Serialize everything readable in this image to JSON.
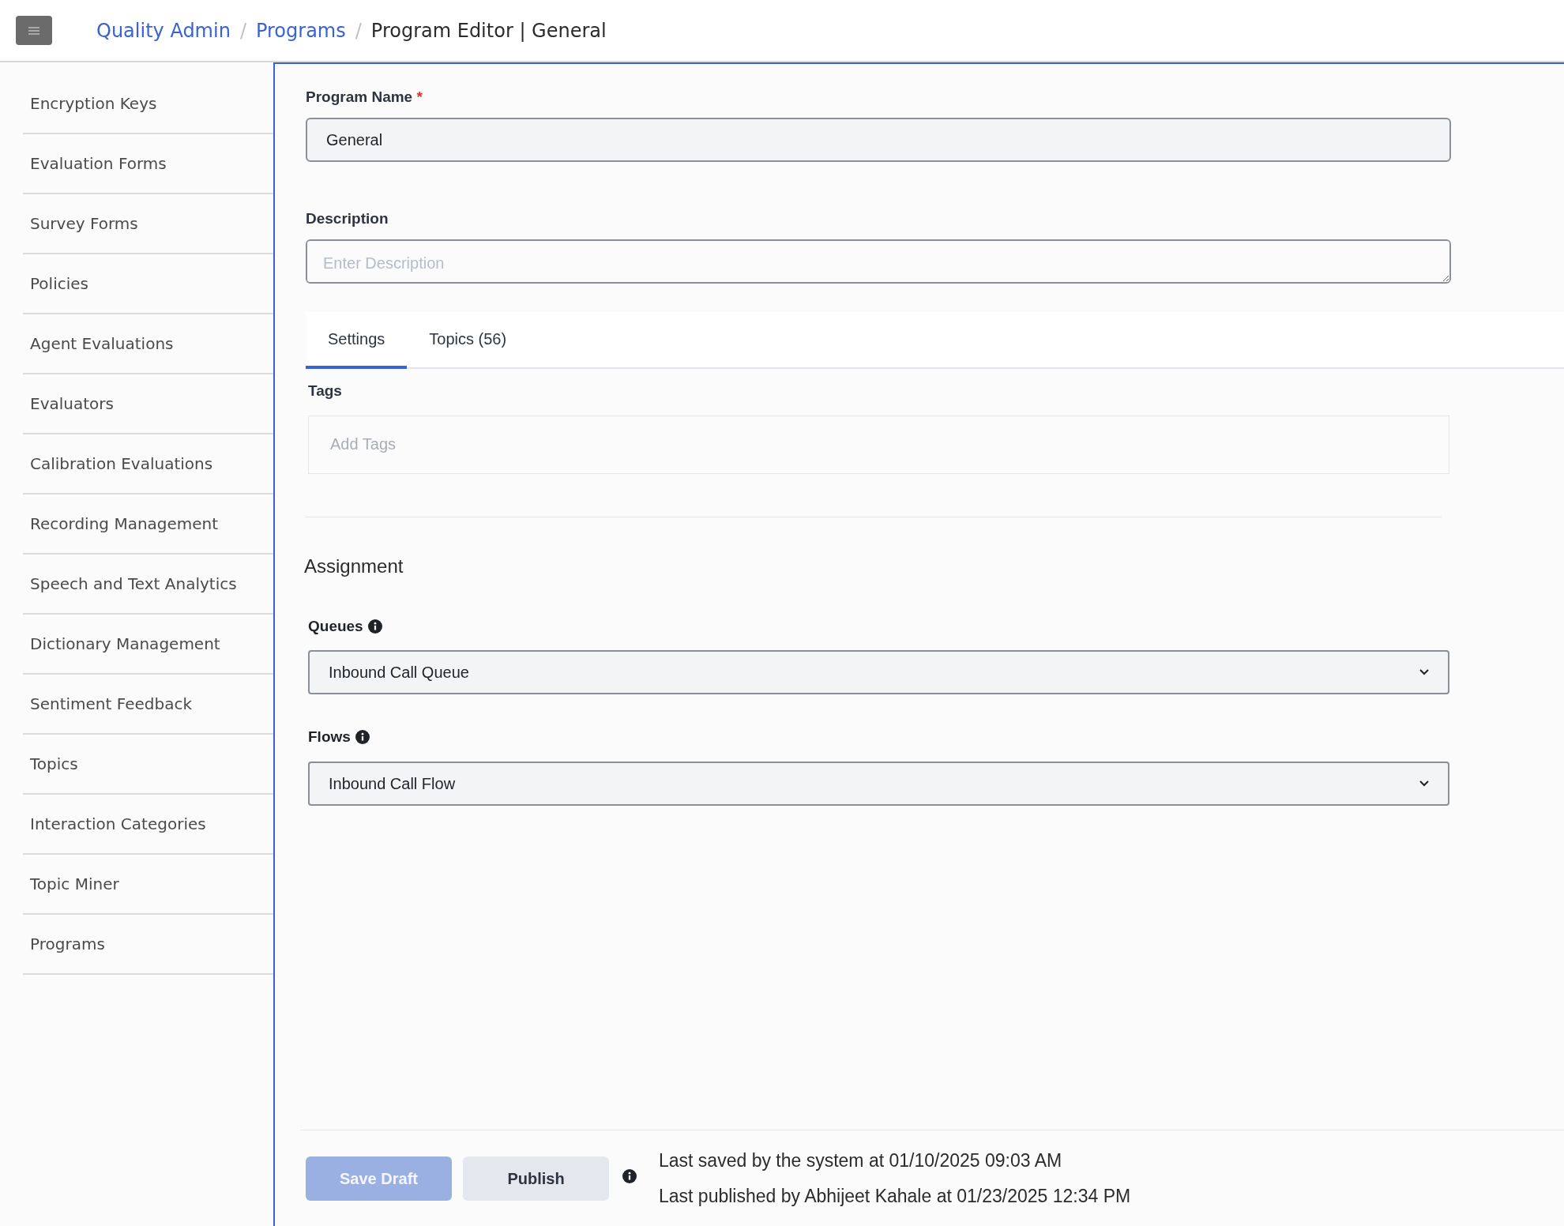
{
  "header": {
    "breadcrumbs": [
      {
        "label": "Quality Admin",
        "kind": "link"
      },
      {
        "label": "Programs",
        "kind": "link"
      },
      {
        "label": "Program Editor | General",
        "kind": "current"
      }
    ],
    "separator": "/"
  },
  "sidebar": {
    "items": [
      "Encryption Keys",
      "Evaluation Forms",
      "Survey Forms",
      "Policies",
      "Agent Evaluations",
      "Evaluators",
      "Calibration Evaluations",
      "Recording Management",
      "Speech and Text Analytics",
      "Dictionary Management",
      "Sentiment Feedback",
      "Topics",
      "Interaction Categories",
      "Topic Miner",
      "Programs"
    ]
  },
  "form": {
    "program_name": {
      "label": "Program Name",
      "required_mark": "*",
      "value": "General"
    },
    "description": {
      "label": "Description",
      "placeholder": "Enter Description"
    },
    "tabs": [
      {
        "label": "Settings",
        "selected": true
      },
      {
        "label": "Topics (56)",
        "selected": false
      }
    ],
    "tags": {
      "label": "Tags",
      "placeholder": "Add Tags"
    },
    "assignment": {
      "title": "Assignment",
      "queues": {
        "label": "Queues",
        "value": "Inbound Call Queue"
      },
      "flows": {
        "label": "Flows",
        "value": "Inbound Call Flow"
      }
    }
  },
  "footer": {
    "buttons": [
      {
        "label": "Save Draft",
        "disabled": true
      },
      {
        "label": "Publish",
        "disabled": false
      }
    ],
    "status_lines": [
      "Last saved by the system at 01/10/2025 09:03 AM",
      "Last published by Abhijeet Kahale at 01/23/2025 12:34 PM"
    ]
  }
}
